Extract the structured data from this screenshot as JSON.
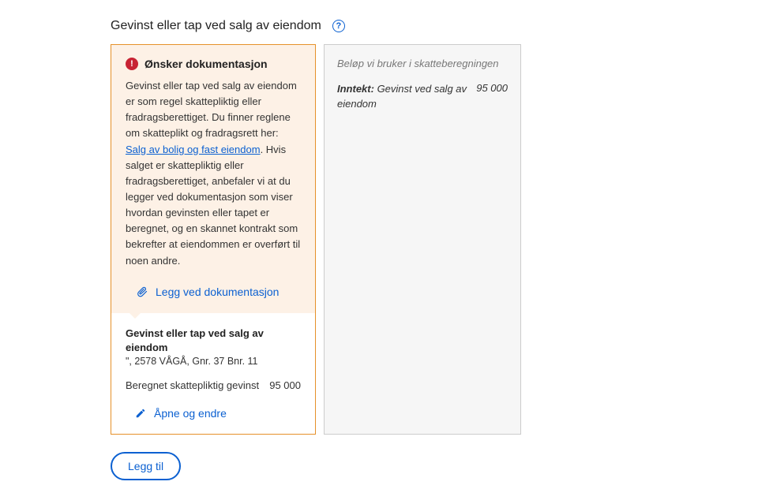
{
  "header": {
    "title": "Gevinst eller tap ved salg av eiendom"
  },
  "warning": {
    "title": "Ønsker dokumentasjon",
    "body_before_link": "Gevinst eller tap ved salg av eiendom er som regel skattepliktig eller fradragsberettiget. Du finner reglene om skatteplikt og fradragsrett her: ",
    "link_text": "Salg av bolig og fast eiendom",
    "body_after_link": ". Hvis salget er skattepliktig eller fradragsberettiget, anbefaler vi at du legger ved dokumentasjon som viser hvordan gevinsten eller tapet er beregnet, og en skannet kontrakt som bekrefter at eiendommen er overført til noen andre.",
    "attach_label": "Legg ved dokumentasjon"
  },
  "item": {
    "title": "Gevinst eller tap ved salg av eiendom",
    "address": "\", 2578 VÅGÅ, Gnr. 37 Bnr. 11",
    "calc_label": "Beregnet skattepliktig gevinst",
    "calc_value": "95 000",
    "edit_label": "Åpne og endre"
  },
  "summary": {
    "heading": "Beløp vi bruker i skatteberegningen",
    "row_label_bold": "Inntekt:",
    "row_label_rest": " Gevinst ved salg av eiendom",
    "row_value": "95 000"
  },
  "buttons": {
    "add": "Legg til"
  }
}
